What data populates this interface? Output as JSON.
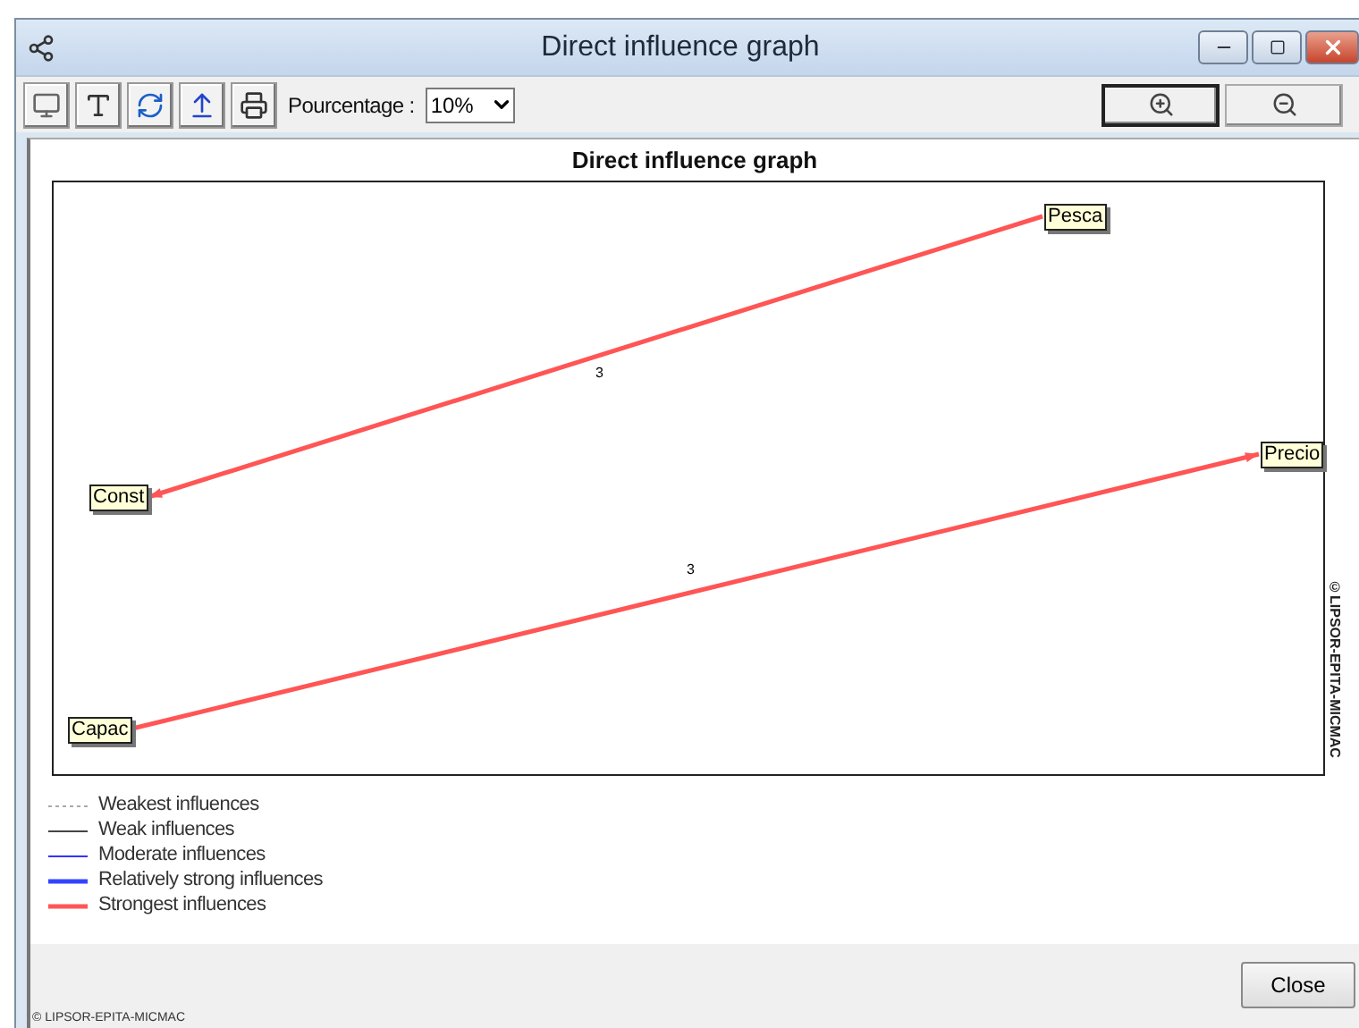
{
  "window": {
    "title": "Direct influence graph"
  },
  "toolbar": {
    "buttons": [
      {
        "kind": "screen"
      },
      {
        "kind": "font"
      },
      {
        "kind": "refresh"
      },
      {
        "kind": "upload"
      },
      {
        "kind": "print"
      }
    ],
    "percentage": {
      "label": "Pourcentage :",
      "value": "10%"
    },
    "zoom_buttons": [
      {
        "kind": "zoom_in",
        "default": true
      },
      {
        "kind": "zoom_out",
        "default": false
      }
    ]
  },
  "graph": {
    "title": "Direct influence graph",
    "copyright": "©LIPSOR-EPITA-MICMAC",
    "nodes": [
      {
        "label": "Pesca"
      },
      {
        "label": "Const"
      },
      {
        "label": "Precio"
      },
      {
        "label": "Capac"
      }
    ],
    "edges": [
      {
        "label": "3",
        "kind": "strongest"
      },
      {
        "label": "3",
        "kind": "strongest"
      }
    ]
  },
  "legend": [
    {
      "label": "Weakest influences",
      "kind": "weakest"
    },
    {
      "label": "Weak influences",
      "kind": "weak"
    },
    {
      "label": "Moderate influences",
      "kind": "moderate"
    },
    {
      "label": "Relatively strong influences",
      "kind": "relatively_strong"
    },
    {
      "label": "Strongest influences",
      "kind": "strongest"
    }
  ],
  "close_button": "Close",
  "footer": "© LIPSOR-EPITA-MICMAC"
}
